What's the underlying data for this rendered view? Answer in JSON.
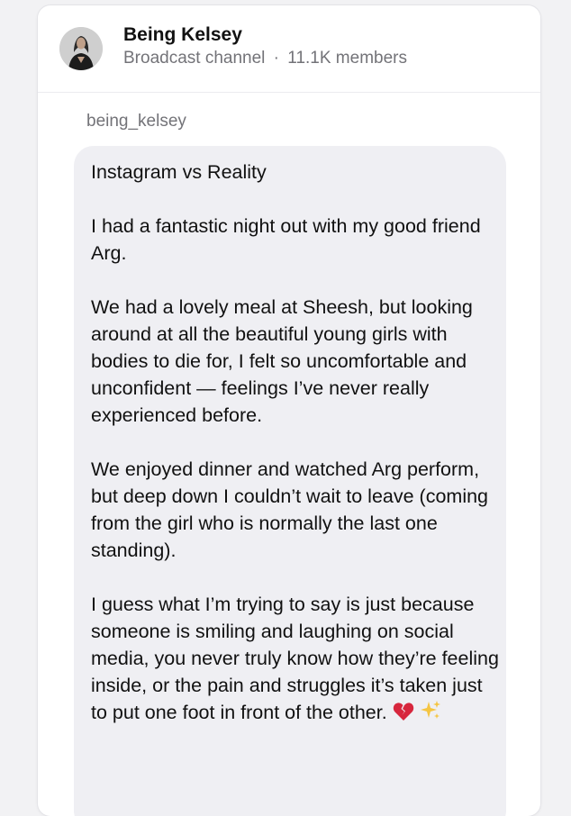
{
  "channel": {
    "name": "Being Kelsey",
    "type": "Broadcast channel",
    "separator": "·",
    "members": "11.1K members"
  },
  "message": {
    "sender": "being_kelsey",
    "paragraphs": [
      "Instagram vs Reality",
      "I had a fantastic night out with my good friend Arg.",
      "We had a lovely meal at Sheesh, but looking around at all the beautiful young girls with bodies to die for, I felt so uncomfortable and unconfident — feelings I’ve never really experienced before.",
      "We enjoyed dinner and watched Arg perform, but deep down I couldn’t wait to leave (coming from the girl who is normally the last one standing).",
      "I guess what I’m trying to say is just because someone is smiling and laughing on social media, you never truly know how they’re feeling inside, or the pain and struggles it’s taken just to put one foot in front of the other."
    ],
    "trailing_icons": [
      "broken-heart-icon",
      "sparkles-icon"
    ]
  },
  "colors": {
    "bubble_bg": "#efeff3",
    "meta_text": "#737378",
    "broken_heart": "#d7263d",
    "sparkles": "#f5c542"
  }
}
